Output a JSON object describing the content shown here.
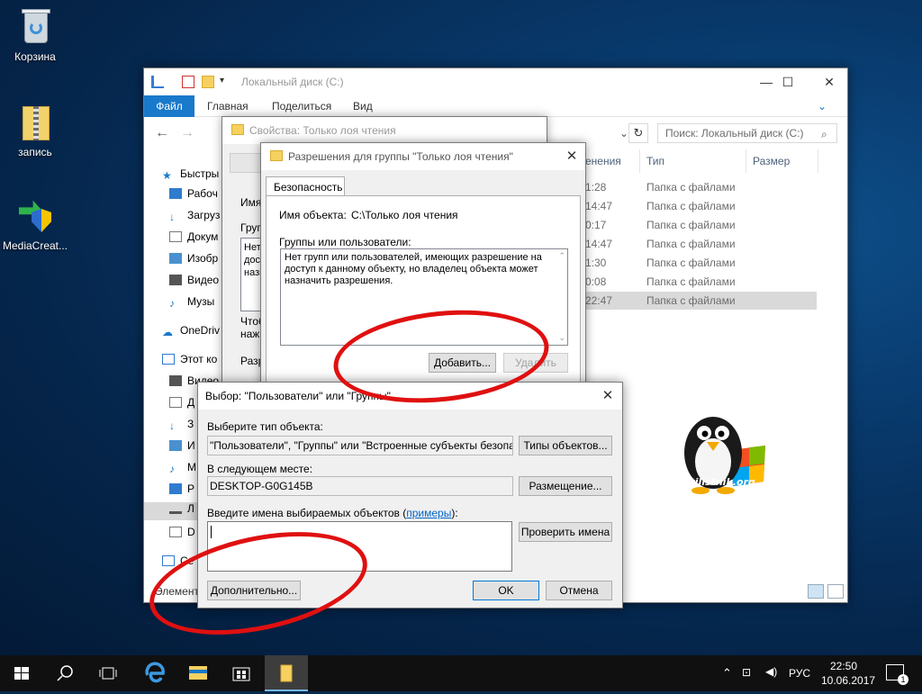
{
  "desktop": {
    "icons": [
      {
        "label": "Корзина"
      },
      {
        "label": "запись"
      },
      {
        "label": "MediaCreat..."
      }
    ]
  },
  "explorer": {
    "title": "Локальный диск (C:)",
    "ribbon_tabs": [
      "Файл",
      "Главная",
      "Поделиться",
      "Вид"
    ],
    "search_placeholder": "Поиск: Локальный диск (C:)",
    "nav_items": [
      "Быстры",
      "Рабоч",
      "Загруз",
      "Докум",
      "Изобр",
      "Видео",
      "Музы",
      "OneDriv",
      "Этот ко",
      "Видео",
      "Д",
      "З",
      "И",
      "М",
      "Р",
      "Л",
      "D",
      "Се"
    ],
    "columns": {
      "date": "енения",
      "type": "Тип",
      "size": "Размер"
    },
    "rows": [
      {
        "time": "1:28",
        "type": "Папка с файлами"
      },
      {
        "time": "14:47",
        "type": "Папка с файлами"
      },
      {
        "time": "0:17",
        "type": "Папка с файлами"
      },
      {
        "time": "14:47",
        "type": "Папка с файлами"
      },
      {
        "time": "1:30",
        "type": "Папка с файлами"
      },
      {
        "time": "0:08",
        "type": "Папка с файлами"
      },
      {
        "time": "22:47",
        "type": "Папка с файлами"
      }
    ],
    "status": "Элемент"
  },
  "properties_dialog": {
    "title": "Свойства: Только лоя чтения",
    "fragments": [
      "Имя",
      "Групп",
      "Нет г",
      "досту",
      "назна",
      "Чтоб",
      "нажм",
      "Разр"
    ]
  },
  "permissions_dialog": {
    "title": "Разрешения для группы \"Только лоя чтения\"",
    "tab": "Безопасность",
    "object_label": "Имя объекта:",
    "object_value": "C:\\Только лоя чтения",
    "groups_label": "Группы или пользователи:",
    "groups_message": "Нет групп или пользователей, имеющих разрешение на доступ к данному объекту, но владелец объекта может назначить разрешения.",
    "add_button": "Добавить...",
    "remove_button": "Удалить"
  },
  "select_dialog": {
    "title": "Выбор: \"Пользователи\" или \"Группы\"",
    "object_type_label": "Выберите тип объекта:",
    "object_type_value": "\"Пользователи\", \"Группы\" или \"Встроенные субъекты безопасности\"",
    "object_types_button": "Типы объектов...",
    "location_label": "В следующем месте:",
    "location_value": "DESKTOP-G0G145B",
    "location_button": "Размещение...",
    "names_label_prefix": "Введите имена выбираемых объектов (",
    "names_label_link": "примеры",
    "names_label_suffix": "):",
    "names_value": "",
    "check_names_button": "Проверить имена",
    "advanced_button": "Дополнительно...",
    "ok_button": "OK",
    "cancel_button": "Отмена"
  },
  "logo": {
    "text": "pyatilistnik.org"
  },
  "taskbar": {
    "language": "РУС",
    "time": "22:50",
    "date": "10.06.2017",
    "notifications": "1"
  }
}
